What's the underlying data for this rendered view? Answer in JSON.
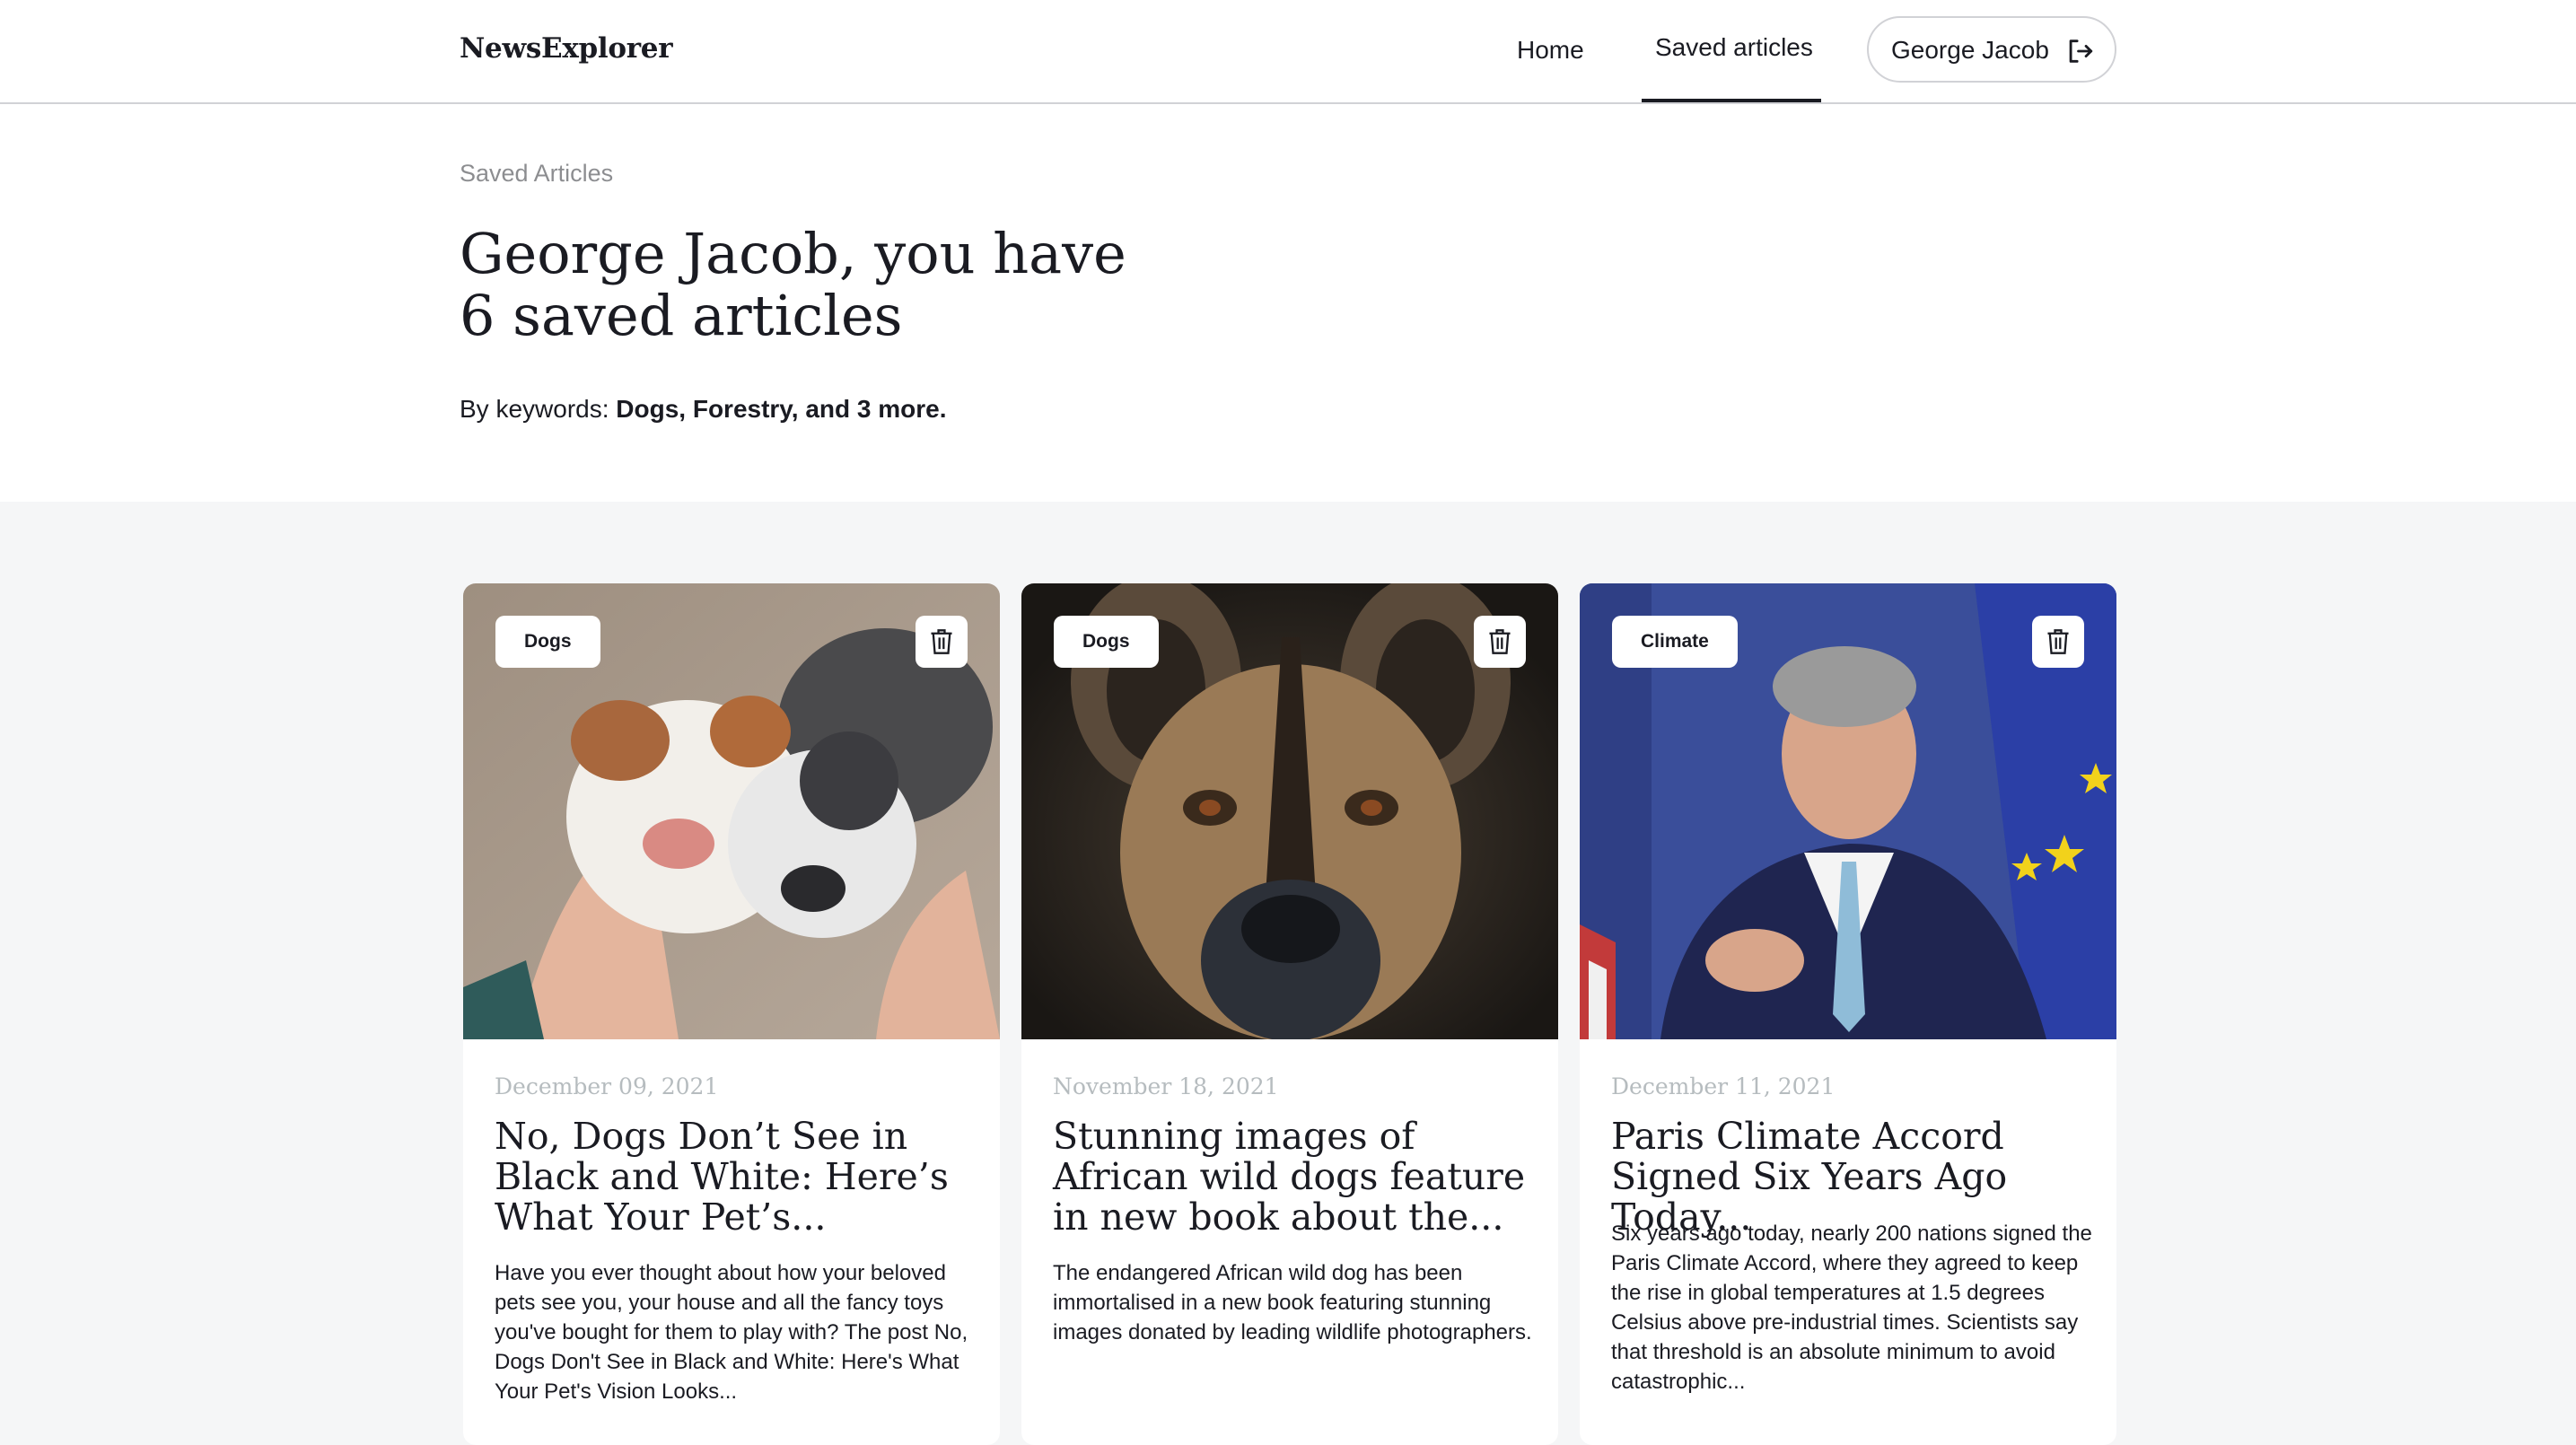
{
  "header": {
    "logo": "NewsExplorer",
    "nav": {
      "home": "Home",
      "saved": "Saved articles"
    },
    "user": "George Jacob",
    "icons": {
      "logout": "logout-icon"
    }
  },
  "hero": {
    "eyebrow": "Saved Articles",
    "title": "George Jacob, you have 6 saved articles",
    "keywords_prefix": "By keywords: ",
    "keywords": "Dogs, Forestry, and 3 more."
  },
  "cards": [
    {
      "tag": "Dogs",
      "date": "December 09, 2021",
      "title": "No, Dogs Don’t See in Black and White: Here’s What Your Pet’s...",
      "text": "Have you ever thought about how your beloved pets see you, your house and all the fancy toys you've bought for them to play with? The post No, Dogs Don't See in Black and White: Here's What Your Pet's Vision Looks..."
    },
    {
      "tag": "Dogs",
      "date": "November 18, 2021",
      "title": "Stunning images of African wild dogs feature in new book about the...",
      "text": "The endangered African wild dog has been immortalised in a new book featuring stunning images donated by leading wildlife photographers."
    },
    {
      "tag": "Climate",
      "date": "December 11, 2021",
      "title": "Paris Climate Accord Signed Six Years Ago Today...",
      "text": "Six years ago today, nearly 200 nations signed the Paris Climate Accord, where they agreed to keep the rise in global temperatures at 1.5 degrees Celsius above pre-industrial times. Scientists say that threshold is an absolute minimum to avoid catastrophic..."
    }
  ]
}
